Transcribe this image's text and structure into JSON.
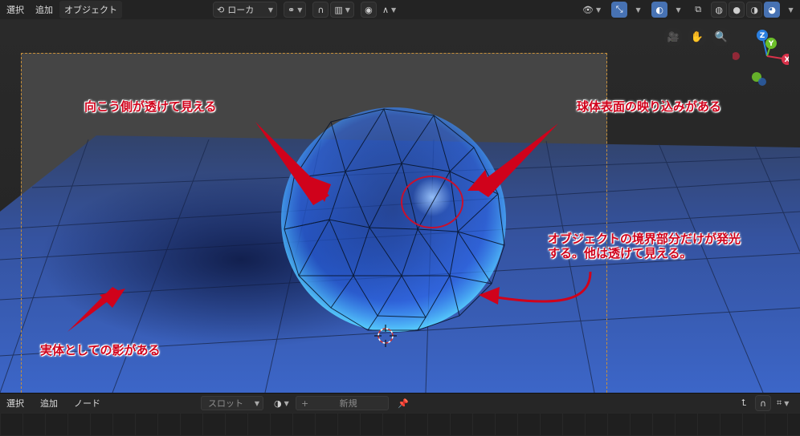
{
  "top_menu": [
    "選択",
    "追加",
    "オブジェクト"
  ],
  "header": {
    "transform_orientation": "ローカ"
  },
  "bottom_menu": [
    "選択",
    "追加",
    "ノード"
  ],
  "shader_header": {
    "slot": "スロット",
    "new_label": "新規",
    "plus": "+"
  },
  "gizmo": {
    "z": "Z",
    "y": "Y",
    "x": "X"
  },
  "annotations": {
    "see_through": "向こう側が透けて見える",
    "reflection": "球体表面の映り込みがある",
    "edge_glow_line1": "オブジェクトの境界部分だけが発光",
    "edge_glow_line2": "する。他は透けて見える。",
    "shadow": "実体としての影がある"
  },
  "colors": {
    "accent": "#4772b3",
    "annotation": "#d0021b",
    "sphere": "#2f8fff",
    "floor": "#3b5fb0",
    "camera_frame": "#c8903a"
  }
}
